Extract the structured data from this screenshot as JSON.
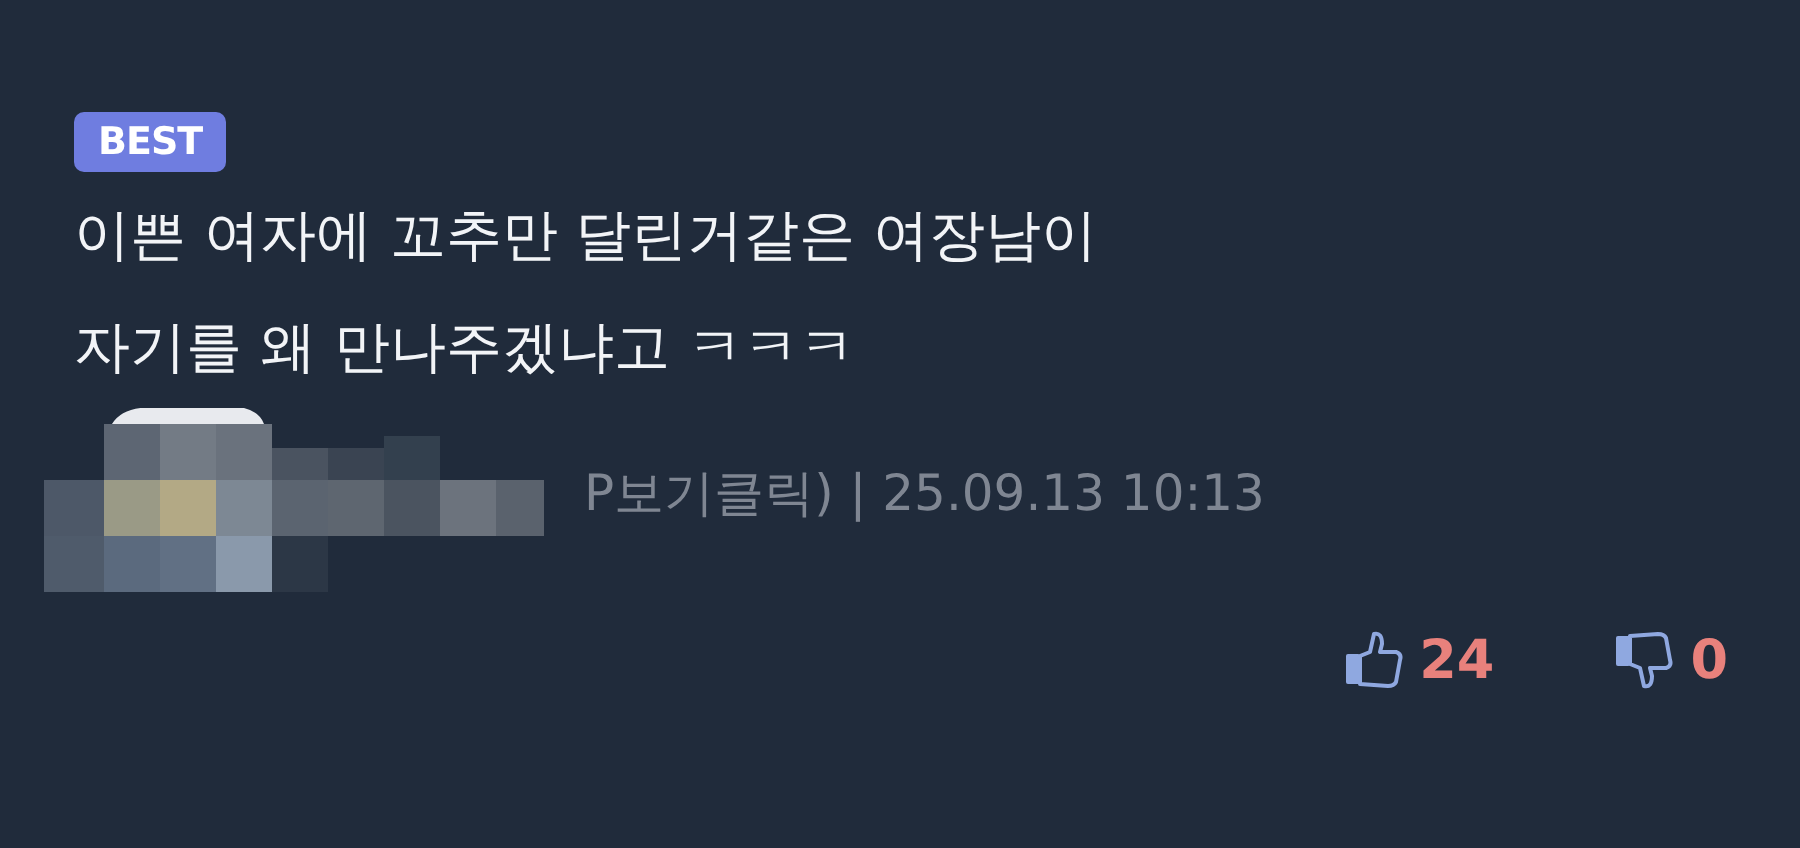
{
  "badge": "BEST",
  "comment": [
    "이쁜 여자에 꼬추만 달린거같은 여장남이",
    "자기를 왜 만나주겠냐고 ㅋㅋㅋ"
  ],
  "meta": "P보기클릭) | 25.09.13 10:13",
  "likes": "24",
  "dislikes": "0"
}
